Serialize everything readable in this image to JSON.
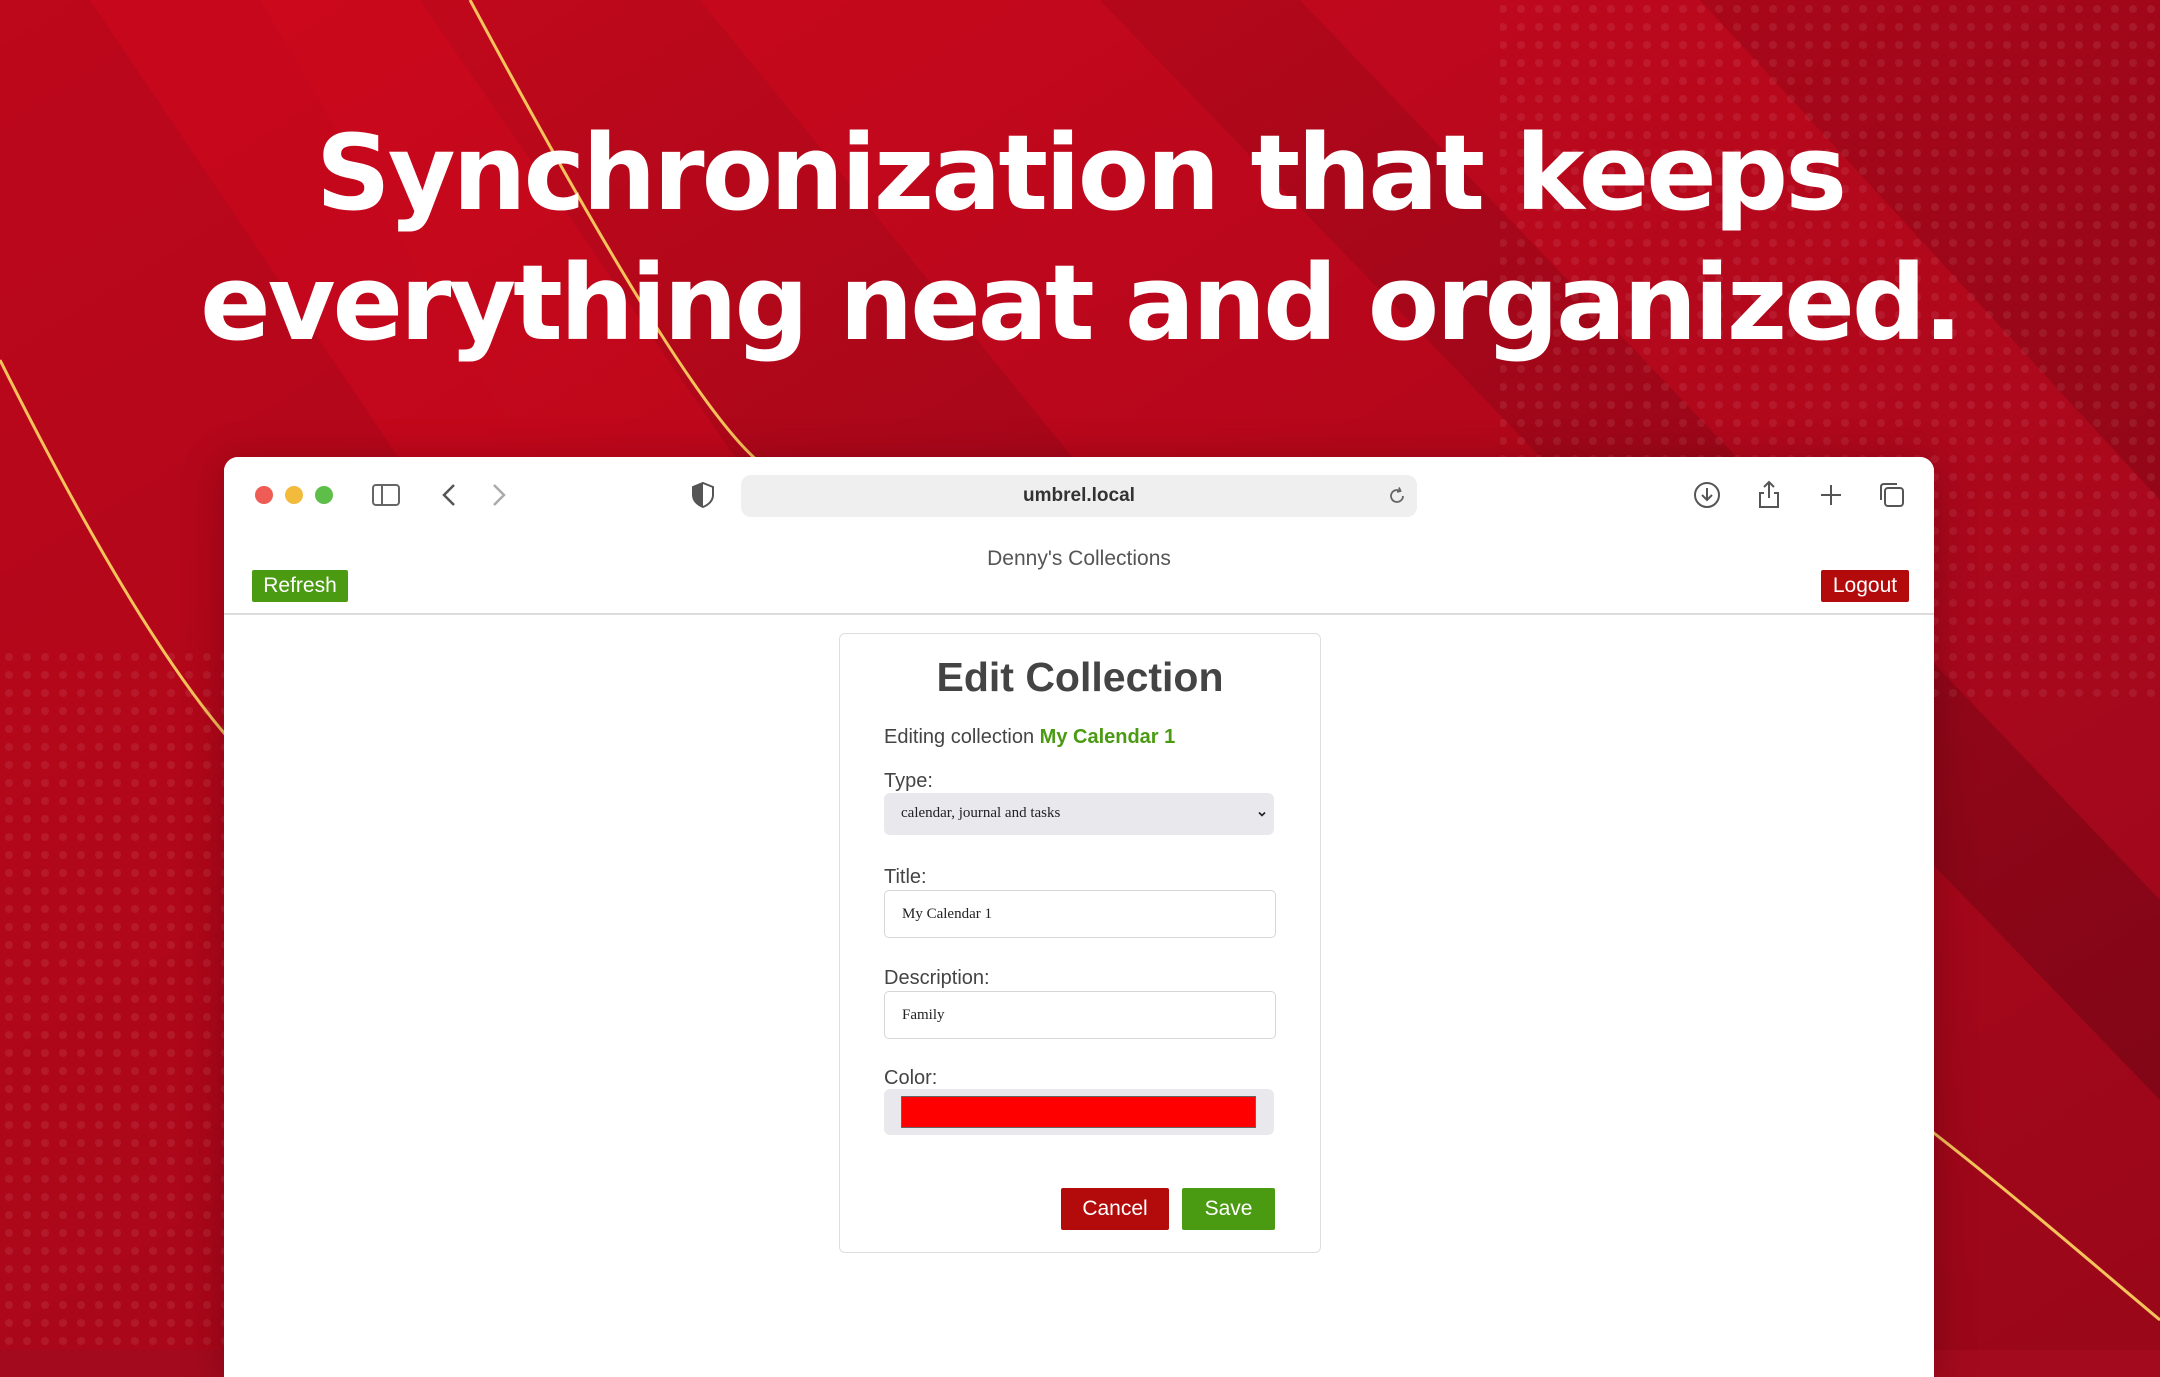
{
  "marketing": {
    "headline_line1": "Synchronization that keeps",
    "headline_line2": "everything neat and organized."
  },
  "colors": {
    "background": "#a40a1e",
    "accent_green": "#4a9a12",
    "accent_red": "#b30b0b",
    "collection_color": "#ff0000"
  },
  "browser": {
    "url": "umbrel.local",
    "toolbar_icons": [
      "sidebar-icon",
      "back-icon",
      "forward-icon",
      "shield-icon",
      "reload-icon",
      "download-icon",
      "share-icon",
      "new-tab-icon",
      "tabs-overview-icon"
    ]
  },
  "app": {
    "title": "Denny's Collections",
    "refresh_label": "Refresh",
    "logout_label": "Logout"
  },
  "form": {
    "heading": "Edit Collection",
    "editing_prefix": "Editing collection",
    "collection_name": "My Calendar 1",
    "type_label": "Type:",
    "type_value": "calendar, journal and tasks",
    "title_label": "Title:",
    "title_value": "My Calendar 1",
    "description_label": "Description:",
    "description_value": "Family",
    "color_label": "Color:",
    "color_value": "#ff0000",
    "cancel_label": "Cancel",
    "save_label": "Save"
  }
}
